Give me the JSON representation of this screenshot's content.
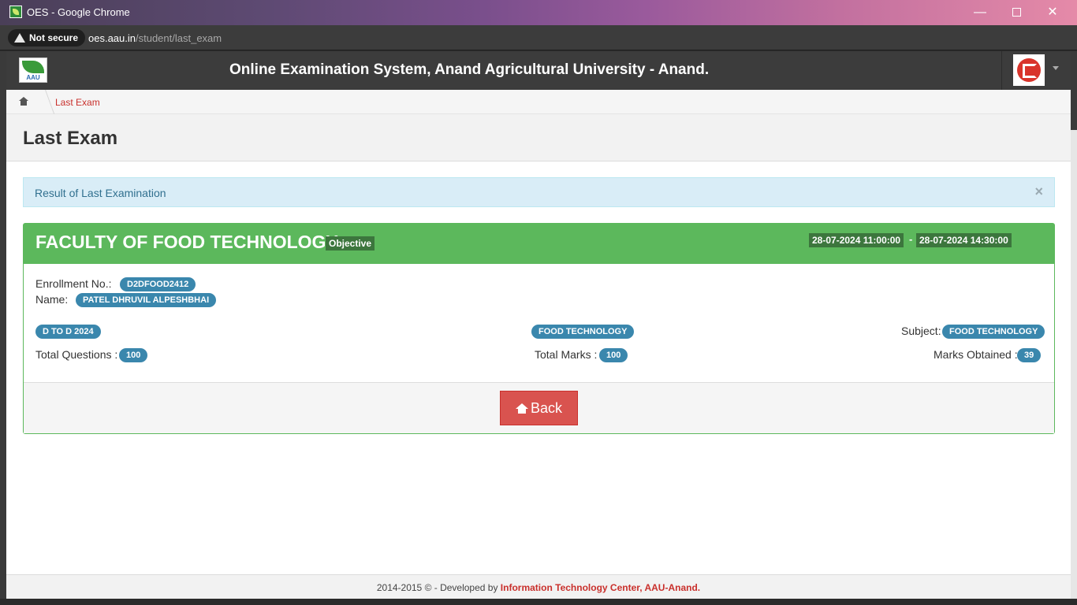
{
  "browser": {
    "window_title": "OES - Google Chrome",
    "security_label": "Not secure",
    "url_host": "oes.aau.in",
    "url_path": "/student/last_exam"
  },
  "navbar": {
    "logo_text": "AAU",
    "title": "Online Examination System, Anand Agricultural University - Anand."
  },
  "breadcrumb": {
    "current": "Last Exam"
  },
  "page": {
    "title": "Last Exam"
  },
  "alert": {
    "message": "Result of Last Examination",
    "close": "×"
  },
  "exam": {
    "faculty": "FACULTY OF FOOD TECHNOLOGY",
    "type": "Objective",
    "start": "28-07-2024 11:00:00",
    "separator": "-",
    "end": "28-07-2024 14:30:00",
    "enrollment_label": "Enrollment No.:",
    "enrollment": "D2DFOOD2412",
    "name_label": "Name:",
    "name": "PATEL DHRUVIL ALPESHBHAI",
    "program": "D TO D 2024",
    "department": "FOOD TECHNOLOGY",
    "subject_label": "Subject:",
    "subject": "FOOD TECHNOLOGY",
    "total_questions_label": "Total Questions :",
    "total_questions": "100",
    "total_marks_label": "Total Marks :",
    "total_marks": "100",
    "marks_obtained_label": "Marks Obtained :",
    "marks_obtained": "39",
    "back_label": "Back"
  },
  "footer": {
    "text": "2014-2015 © - Developed by",
    "link": "Information Technology Center, AAU-Anand."
  },
  "colors": {
    "panel_green": "#5cb85c",
    "badge_blue": "#3a87ad",
    "danger_red": "#d9534f",
    "alert_bg": "#d9edf7"
  }
}
